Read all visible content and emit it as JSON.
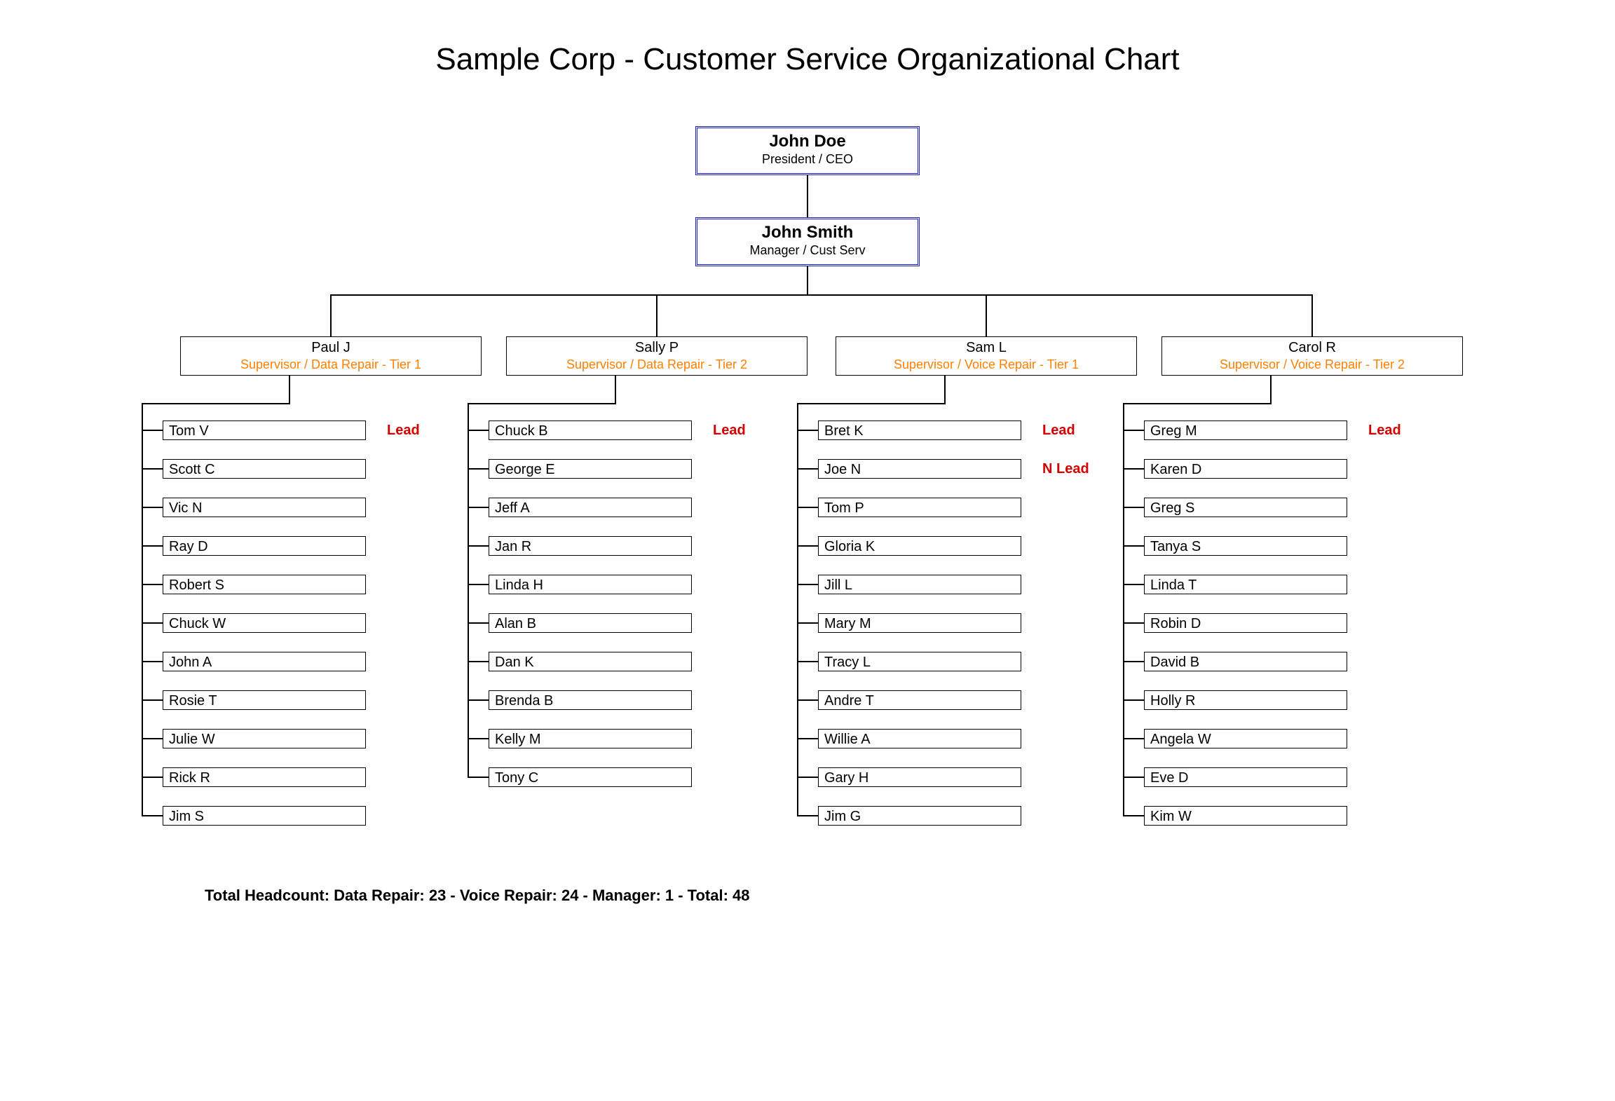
{
  "title": "Sample Corp - Customer Service Organizational Chart",
  "ceo": {
    "name": "John Doe",
    "title": "President / CEO"
  },
  "manager": {
    "name": "John Smith",
    "title": "Manager / Cust Serv"
  },
  "supervisors": [
    {
      "name": "Paul J",
      "title": "Supervisor / Data Repair - Tier 1"
    },
    {
      "name": "Sally P",
      "title": "Supervisor / Data Repair - Tier 2"
    },
    {
      "name": "Sam L",
      "title": "Supervisor / Voice Repair - Tier 1"
    },
    {
      "name": "Carol R",
      "title": "Supervisor / Voice Repair - Tier 2"
    }
  ],
  "columns": [
    {
      "employees": [
        "Tom V",
        "Scott C",
        "Vic N",
        "Ray D",
        "Robert S",
        "Chuck W",
        "John A",
        "Rosie T",
        "Julie W",
        "Rick R",
        "Jim S"
      ],
      "tags": {
        "0": "Lead"
      }
    },
    {
      "employees": [
        "Chuck B",
        "George E",
        "Jeff A",
        "Jan R",
        "Linda H",
        "Alan B",
        "Dan K",
        "Brenda B",
        "Kelly M",
        "Tony C"
      ],
      "tags": {
        "0": "Lead"
      }
    },
    {
      "employees": [
        "Bret K",
        "Joe N",
        "Tom P",
        "Gloria K",
        "Jill L",
        "Mary M",
        "Tracy L",
        "Andre T",
        "Willie A",
        "Gary H",
        "Jim G"
      ],
      "tags": {
        "0": "Lead",
        "1": "N Lead"
      }
    },
    {
      "employees": [
        "Greg M",
        "Karen D",
        "Greg S",
        "Tanya S",
        "Linda T",
        "Robin D",
        "David B",
        "Holly R",
        "Angela W",
        "Eve D",
        "Kim W"
      ],
      "tags": {
        "0": "Lead"
      }
    }
  ],
  "summary": "Total Headcount:  Data Repair: 23  -  Voice Repair: 24  -  Manager: 1  -   Total: 48",
  "chart_data": {
    "type": "org-chart",
    "root": {
      "name": "John Doe",
      "title": "President / CEO",
      "children": [
        {
          "name": "John Smith",
          "title": "Manager / Cust Serv",
          "children": [
            {
              "name": "Paul J",
              "title": "Supervisor / Data Repair - Tier 1",
              "children": [
                {
                  "name": "Tom V",
                  "tag": "Lead"
                },
                {
                  "name": "Scott C"
                },
                {
                  "name": "Vic N"
                },
                {
                  "name": "Ray D"
                },
                {
                  "name": "Robert S"
                },
                {
                  "name": "Chuck W"
                },
                {
                  "name": "John A"
                },
                {
                  "name": "Rosie T"
                },
                {
                  "name": "Julie W"
                },
                {
                  "name": "Rick R"
                },
                {
                  "name": "Jim S"
                }
              ]
            },
            {
              "name": "Sally P",
              "title": "Supervisor / Data Repair - Tier 2",
              "children": [
                {
                  "name": "Chuck B",
                  "tag": "Lead"
                },
                {
                  "name": "George E"
                },
                {
                  "name": "Jeff A"
                },
                {
                  "name": "Jan R"
                },
                {
                  "name": "Linda H"
                },
                {
                  "name": "Alan B"
                },
                {
                  "name": "Dan K"
                },
                {
                  "name": "Brenda B"
                },
                {
                  "name": "Kelly M"
                },
                {
                  "name": "Tony C"
                }
              ]
            },
            {
              "name": "Sam L",
              "title": "Supervisor / Voice Repair - Tier 1",
              "children": [
                {
                  "name": "Bret K",
                  "tag": "Lead"
                },
                {
                  "name": "Joe N",
                  "tag": "N Lead"
                },
                {
                  "name": "Tom P"
                },
                {
                  "name": "Gloria K"
                },
                {
                  "name": "Jill L"
                },
                {
                  "name": "Mary M"
                },
                {
                  "name": "Tracy L"
                },
                {
                  "name": "Andre T"
                },
                {
                  "name": "Willie A"
                },
                {
                  "name": "Gary H"
                },
                {
                  "name": "Jim G"
                }
              ]
            },
            {
              "name": "Carol R",
              "title": "Supervisor / Voice Repair - Tier 2",
              "children": [
                {
                  "name": "Greg M",
                  "tag": "Lead"
                },
                {
                  "name": "Karen D"
                },
                {
                  "name": "Greg S"
                },
                {
                  "name": "Tanya S"
                },
                {
                  "name": "Linda T"
                },
                {
                  "name": "Robin D"
                },
                {
                  "name": "David B"
                },
                {
                  "name": "Holly R"
                },
                {
                  "name": "Angela W"
                },
                {
                  "name": "Eve D"
                },
                {
                  "name": "Kim W"
                }
              ]
            }
          ]
        }
      ]
    },
    "headcount": {
      "data_repair": 23,
      "voice_repair": 24,
      "manager": 1,
      "total": 48
    }
  }
}
